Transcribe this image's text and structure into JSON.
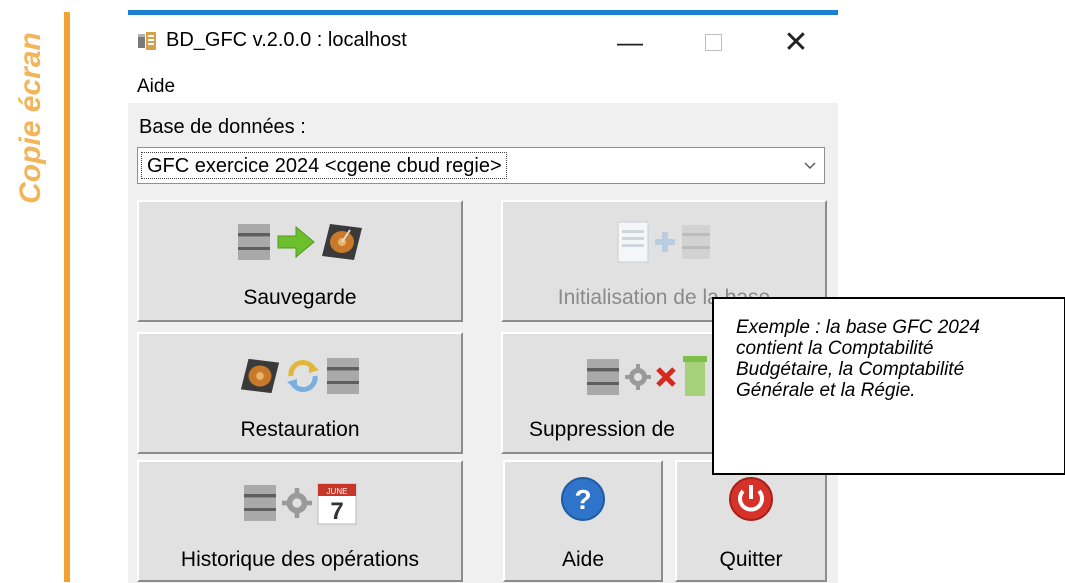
{
  "margin_label": "Copie écran",
  "window": {
    "title": "BD_GFC v.2.0.0 : localhost",
    "controls": {
      "minimize": "—",
      "maximize": "☐",
      "close": "✕"
    }
  },
  "menu": {
    "items": [
      "Aide"
    ]
  },
  "database": {
    "label": "Base de données :",
    "selected": "GFC exercice 2024 <cgene cbud regie>"
  },
  "buttons": {
    "sauvegarde": "Sauvegarde",
    "initialisation": "Initialisation de la base",
    "restauration": "Restauration",
    "suppression": "Suppression de",
    "historique": "Historique des opérations",
    "aide": "Aide",
    "quitter": "Quitter"
  },
  "calendar_icon": {
    "month": "JUNE",
    "day": "7"
  },
  "callout": {
    "lines": [
      "Exemple : la base GFC 2024",
      "contient la Comptabilité",
      "Budgétaire, la Comptabilité",
      "Générale et la Régie."
    ]
  },
  "icons": [
    "database-icon",
    "arrow-right-icon",
    "hard-drive-icon",
    "document-icon",
    "plus-icon",
    "refresh-icon",
    "gear-icon",
    "delete-x-icon",
    "trash-icon",
    "calendar-icon",
    "help-icon",
    "power-icon"
  ],
  "colors": {
    "accent_bar": "#f0a235",
    "title_accent": "#1c7fd0"
  }
}
